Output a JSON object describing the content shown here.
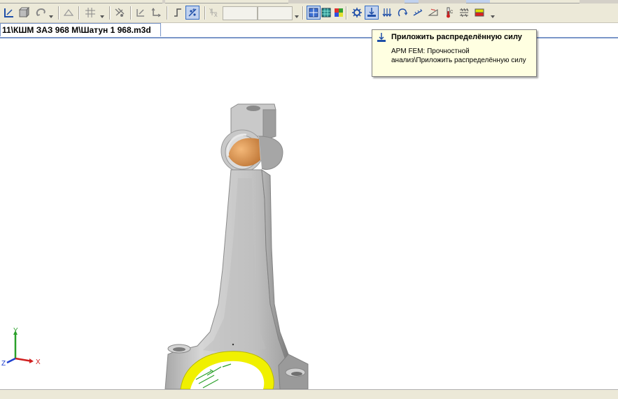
{
  "document_tab": {
    "title": "11\\КШМ ЗАЗ 968 М\\Шатун 1 968.m3d"
  },
  "tooltip": {
    "title": "Приложить распределённую силу",
    "description": "APM FEM: Прочностной анализ\\Приложить распределённую силу"
  },
  "toolbar": {
    "left_buttons": [
      "sketch-icon",
      "view-icon",
      "rotate-icon",
      "plane-icon",
      "grid-icon",
      "snap-icon",
      "constraint-icon",
      "axis-icon",
      "step-icon",
      "point-icon"
    ],
    "fem_buttons": [
      "mesh-settings-icon",
      "fixing-icon",
      "material-icon",
      "gear-icon",
      "distributed-force-icon",
      "force-icon",
      "torque-icon",
      "pressure-icon",
      "temperature-icon",
      "thermometer-icon",
      "heat-icon",
      "results-icon"
    ],
    "x_field_value": "",
    "y_field_value": ""
  },
  "axis_triad": {
    "x_label": "X",
    "y_label": "Y",
    "z_label": "Z"
  },
  "colors": {
    "toolbar_bg": "#ece9d8",
    "tab_border": "#7a96c8",
    "tooltip_bg": "#ffffe1",
    "model_gray": "#c8c8c8",
    "bearing_orange": "#e8a060",
    "load_yellow": "#f0f000"
  }
}
